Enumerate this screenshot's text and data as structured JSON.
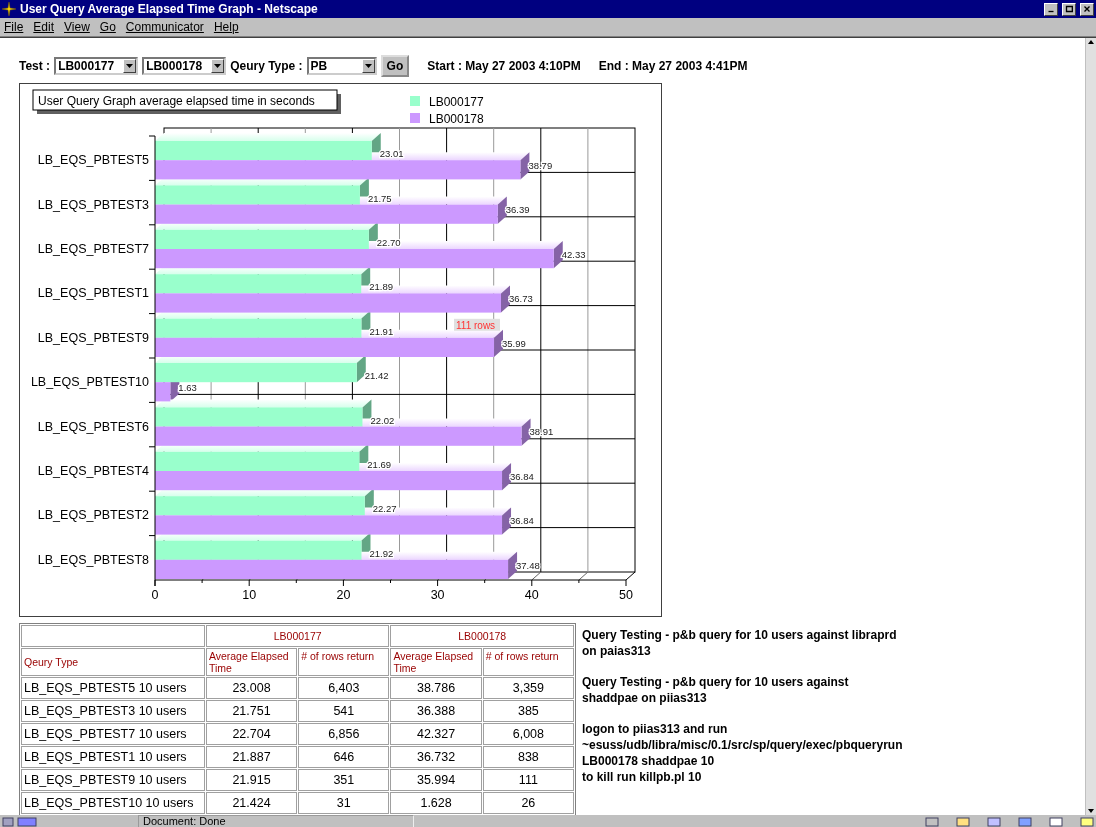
{
  "window": {
    "title": "User Query Average Elapsed Time Graph - Netscape"
  },
  "menu": [
    "File",
    "Edit",
    "View",
    "Go",
    "Communicator",
    "Help"
  ],
  "form": {
    "test_label": "Test :",
    "test_selects": [
      "LB000177",
      "LB000178"
    ],
    "query_type_label": "Qeury Type :",
    "query_type": "PB",
    "go_button": "Go",
    "start": "Start : May 27 2003 4:10PM",
    "end": "End : May 27 2003 4:41PM"
  },
  "chart": {
    "chart_data": {
      "type": "bar",
      "orientation": "horizontal",
      "title": "User Query Graph average elapsed time in seconds",
      "legend": "top",
      "categories": [
        "LB_EQS_PBTEST5",
        "LB_EQS_PBTEST3",
        "LB_EQS_PBTEST7",
        "LB_EQS_PBTEST1",
        "LB_EQS_PBTEST9",
        "LB_EQS_PBTEST10",
        "LB_EQS_PBTEST6",
        "LB_EQS_PBTEST4",
        "LB_EQS_PBTEST2",
        "LB_EQS_PBTEST8"
      ],
      "series": [
        {
          "name": "LB000177",
          "color": "#99ffcc",
          "values": [
            23.01,
            21.75,
            22.7,
            21.89,
            21.91,
            21.42,
            22.02,
            21.69,
            22.27,
            21.92
          ],
          "value_labels": [
            "23.01",
            "21.75",
            "22.70",
            "21.89",
            "21.91",
            "21.42",
            "22.02",
            "21.69",
            "22.27",
            "21.92"
          ]
        },
        {
          "name": "LB000178",
          "color": "#cc99ff",
          "values": [
            38.79,
            36.39,
            42.33,
            36.73,
            35.99,
            1.63,
            38.91,
            36.84,
            36.84,
            37.48
          ],
          "value_labels": [
            "38.79",
            "36.39",
            "42.33",
            "36.73",
            "35.99",
            "1.63",
            "38.91",
            "36.84",
            "36.84",
            "37.48"
          ]
        }
      ],
      "xlim": [
        0,
        50
      ],
      "xticks": [
        0,
        10,
        20,
        30,
        40,
        50
      ],
      "data_labels": true,
      "annotations": [
        {
          "text": "111 rows",
          "x": 35.99,
          "y": "LB_EQS_PBTEST9"
        }
      ]
    }
  },
  "table": {
    "group_headers": [
      "LB000177",
      "LB000178"
    ],
    "columns": [
      "Qeury Type",
      "Average Elapsed Time",
      "# of rows return",
      "Average Elapsed Time",
      "# of rows return"
    ],
    "rows": [
      [
        "LB_EQS_PBTEST5 10 users",
        "23.008",
        "6,403",
        "38.786",
        "3,359"
      ],
      [
        "LB_EQS_PBTEST3 10 users",
        "21.751",
        "541",
        "36.388",
        "385"
      ],
      [
        "LB_EQS_PBTEST7 10 users",
        "22.704",
        "6,856",
        "42.327",
        "6,008"
      ],
      [
        "LB_EQS_PBTEST1 10 users",
        "21.887",
        "646",
        "36.732",
        "838"
      ],
      [
        "LB_EQS_PBTEST9 10 users",
        "21.915",
        "351",
        "35.994",
        "111"
      ],
      [
        "LB_EQS_PBTEST10 10 users",
        "21.424",
        "31",
        "1.628",
        "26"
      ]
    ]
  },
  "notes": [
    "Query Testing - p&b query for 10 users against libraprd\non paias313",
    "Query Testing - p&b query for 10 users against\nshaddpae on piias313",
    "logon to piias313 and run\n~esuss/udb/libra/misc/0.1/src/sp/query/exec/pbqueryrun\nLB000178 shaddpae 10\nto kill run killpb.pl 10"
  ],
  "status_bar": {
    "text": "Document: Done"
  }
}
